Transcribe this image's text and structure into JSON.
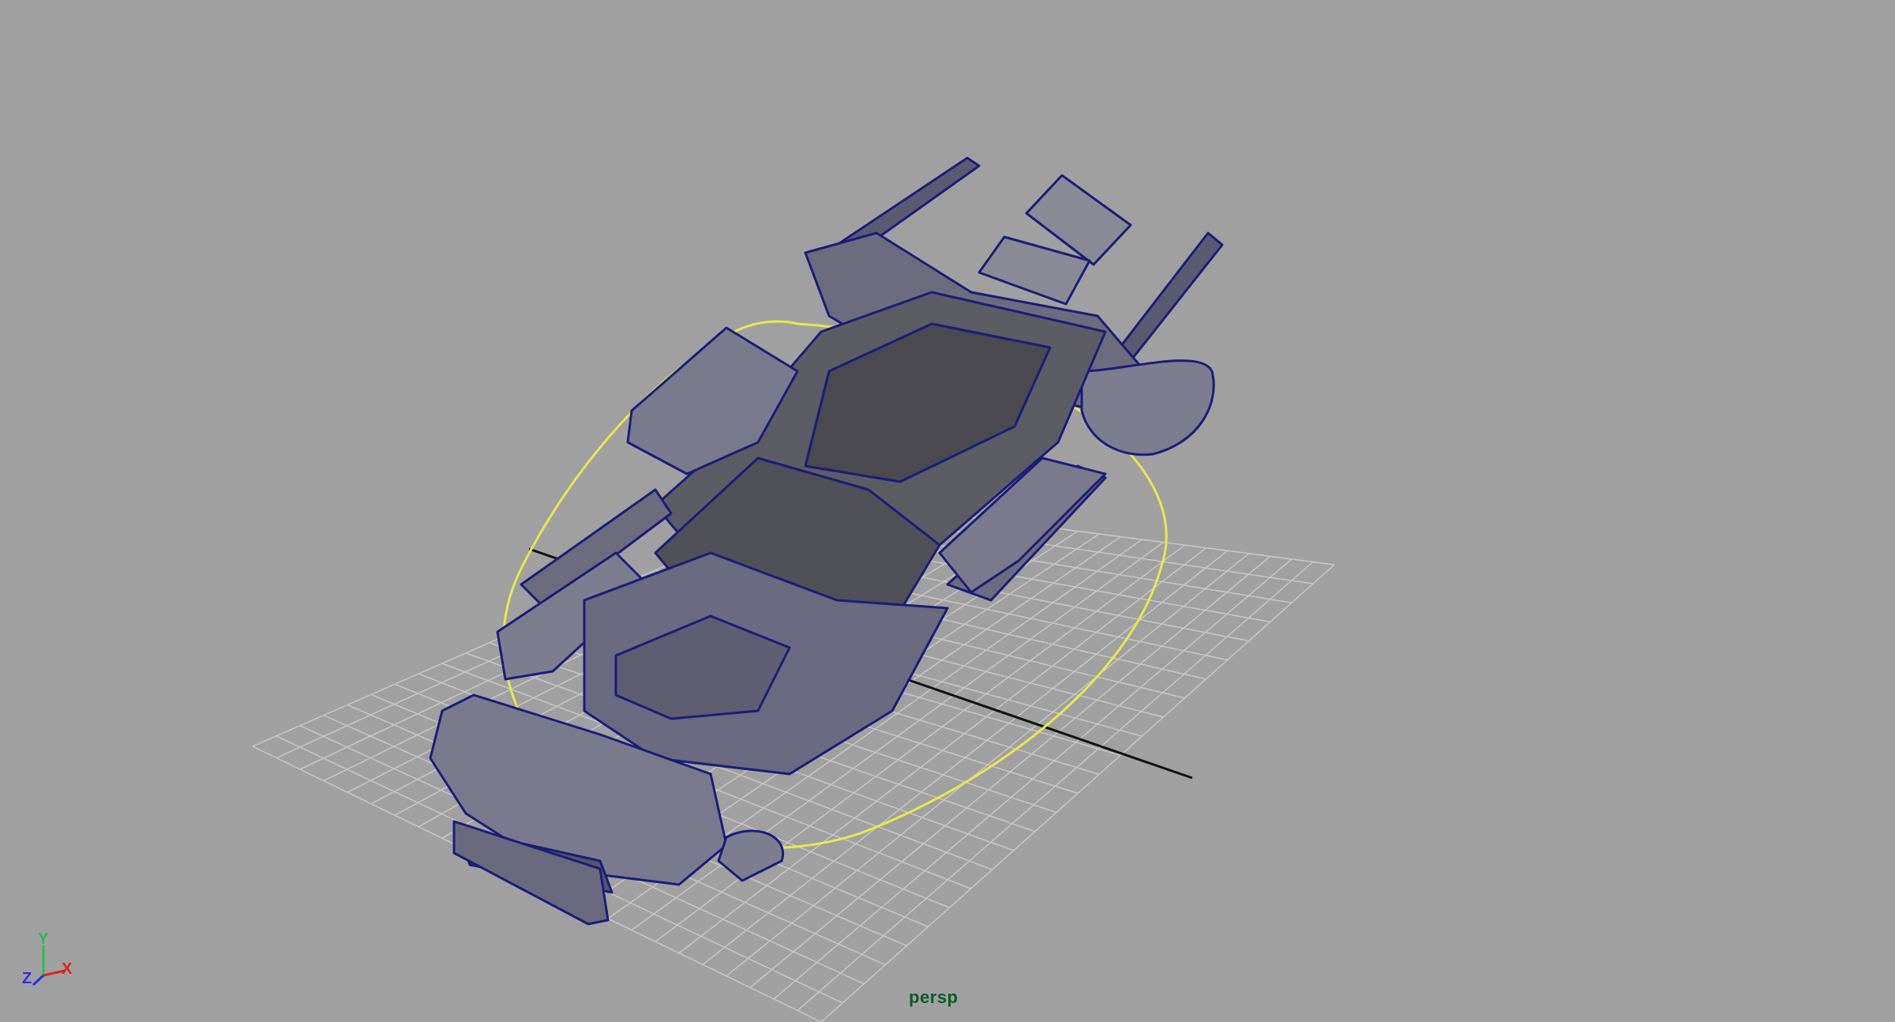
{
  "viewport": {
    "camera_label": "persp",
    "background_color": "#a0a0a0"
  },
  "axis_indicator": {
    "y_label": "Y",
    "z_label": "Z",
    "x_label": "X",
    "y_color": "#22c244",
    "z_color": "#2a2aee",
    "x_color": "#e02020"
  },
  "scene": {
    "model": "car-body-parts-wireframe",
    "selection_color": "#e8e84a",
    "wire_color": "#1a1a80",
    "grid_color": "#c8c8c8"
  }
}
